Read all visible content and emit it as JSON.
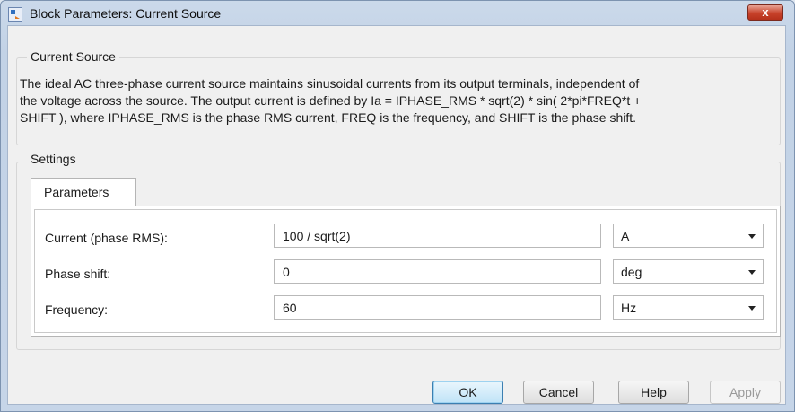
{
  "window": {
    "title": "Block Parameters: Current Source",
    "close_label": "x"
  },
  "current_source_group": {
    "label": "Current Source",
    "description_lines": [
      "The ideal AC three-phase current source maintains sinusoidal currents from its output terminals, independent of",
      "the voltage across the source. The output current is defined by Ia = IPHASE_RMS * sqrt(2) * sin( 2*pi*FREQ*t +",
      "SHIFT ), where IPHASE_RMS is the phase RMS current, FREQ is the frequency, and SHIFT is the phase shift."
    ]
  },
  "settings_group": {
    "label": "Settings",
    "tab_label": "Parameters",
    "params": [
      {
        "label": "Current (phase RMS):",
        "value": "100 / sqrt(2)",
        "unit": "A"
      },
      {
        "label": "Phase shift:",
        "value": "0",
        "unit": "deg"
      },
      {
        "label": "Frequency:",
        "value": "60",
        "unit": "Hz"
      }
    ]
  },
  "buttons": {
    "ok": "OK",
    "cancel": "Cancel",
    "help": "Help",
    "apply": "Apply"
  },
  "colors": {
    "accent": "#3c7fb1",
    "close": "#c7412a"
  }
}
